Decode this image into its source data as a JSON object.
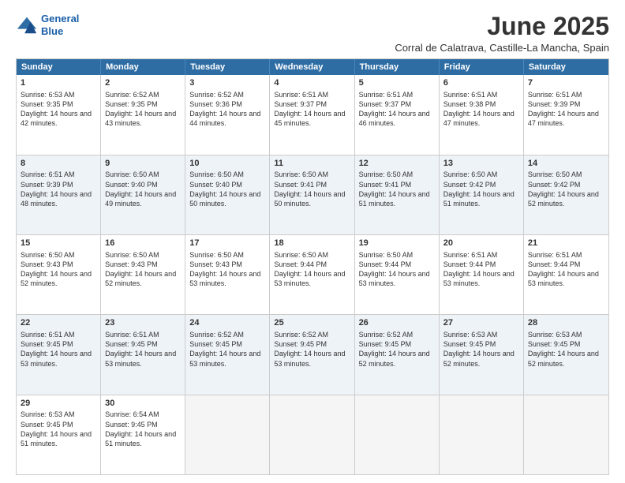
{
  "logo": {
    "line1": "General",
    "line2": "Blue"
  },
  "title": "June 2025",
  "subtitle": "Corral de Calatrava, Castille-La Mancha, Spain",
  "days": [
    "Sunday",
    "Monday",
    "Tuesday",
    "Wednesday",
    "Thursday",
    "Friday",
    "Saturday"
  ],
  "rows": [
    [
      {
        "num": "1",
        "rise": "Sunrise: 6:53 AM",
        "set": "Sunset: 9:35 PM",
        "day": "Daylight: 14 hours and 42 minutes."
      },
      {
        "num": "2",
        "rise": "Sunrise: 6:52 AM",
        "set": "Sunset: 9:35 PM",
        "day": "Daylight: 14 hours and 43 minutes."
      },
      {
        "num": "3",
        "rise": "Sunrise: 6:52 AM",
        "set": "Sunset: 9:36 PM",
        "day": "Daylight: 14 hours and 44 minutes."
      },
      {
        "num": "4",
        "rise": "Sunrise: 6:51 AM",
        "set": "Sunset: 9:37 PM",
        "day": "Daylight: 14 hours and 45 minutes."
      },
      {
        "num": "5",
        "rise": "Sunrise: 6:51 AM",
        "set": "Sunset: 9:37 PM",
        "day": "Daylight: 14 hours and 46 minutes."
      },
      {
        "num": "6",
        "rise": "Sunrise: 6:51 AM",
        "set": "Sunset: 9:38 PM",
        "day": "Daylight: 14 hours and 47 minutes."
      },
      {
        "num": "7",
        "rise": "Sunrise: 6:51 AM",
        "set": "Sunset: 9:39 PM",
        "day": "Daylight: 14 hours and 47 minutes."
      }
    ],
    [
      {
        "num": "8",
        "rise": "Sunrise: 6:51 AM",
        "set": "Sunset: 9:39 PM",
        "day": "Daylight: 14 hours and 48 minutes."
      },
      {
        "num": "9",
        "rise": "Sunrise: 6:50 AM",
        "set": "Sunset: 9:40 PM",
        "day": "Daylight: 14 hours and 49 minutes."
      },
      {
        "num": "10",
        "rise": "Sunrise: 6:50 AM",
        "set": "Sunset: 9:40 PM",
        "day": "Daylight: 14 hours and 50 minutes."
      },
      {
        "num": "11",
        "rise": "Sunrise: 6:50 AM",
        "set": "Sunset: 9:41 PM",
        "day": "Daylight: 14 hours and 50 minutes."
      },
      {
        "num": "12",
        "rise": "Sunrise: 6:50 AM",
        "set": "Sunset: 9:41 PM",
        "day": "Daylight: 14 hours and 51 minutes."
      },
      {
        "num": "13",
        "rise": "Sunrise: 6:50 AM",
        "set": "Sunset: 9:42 PM",
        "day": "Daylight: 14 hours and 51 minutes."
      },
      {
        "num": "14",
        "rise": "Sunrise: 6:50 AM",
        "set": "Sunset: 9:42 PM",
        "day": "Daylight: 14 hours and 52 minutes."
      }
    ],
    [
      {
        "num": "15",
        "rise": "Sunrise: 6:50 AM",
        "set": "Sunset: 9:43 PM",
        "day": "Daylight: 14 hours and 52 minutes."
      },
      {
        "num": "16",
        "rise": "Sunrise: 6:50 AM",
        "set": "Sunset: 9:43 PM",
        "day": "Daylight: 14 hours and 52 minutes."
      },
      {
        "num": "17",
        "rise": "Sunrise: 6:50 AM",
        "set": "Sunset: 9:43 PM",
        "day": "Daylight: 14 hours and 53 minutes."
      },
      {
        "num": "18",
        "rise": "Sunrise: 6:50 AM",
        "set": "Sunset: 9:44 PM",
        "day": "Daylight: 14 hours and 53 minutes."
      },
      {
        "num": "19",
        "rise": "Sunrise: 6:50 AM",
        "set": "Sunset: 9:44 PM",
        "day": "Daylight: 14 hours and 53 minutes."
      },
      {
        "num": "20",
        "rise": "Sunrise: 6:51 AM",
        "set": "Sunset: 9:44 PM",
        "day": "Daylight: 14 hours and 53 minutes."
      },
      {
        "num": "21",
        "rise": "Sunrise: 6:51 AM",
        "set": "Sunset: 9:44 PM",
        "day": "Daylight: 14 hours and 53 minutes."
      }
    ],
    [
      {
        "num": "22",
        "rise": "Sunrise: 6:51 AM",
        "set": "Sunset: 9:45 PM",
        "day": "Daylight: 14 hours and 53 minutes."
      },
      {
        "num": "23",
        "rise": "Sunrise: 6:51 AM",
        "set": "Sunset: 9:45 PM",
        "day": "Daylight: 14 hours and 53 minutes."
      },
      {
        "num": "24",
        "rise": "Sunrise: 6:52 AM",
        "set": "Sunset: 9:45 PM",
        "day": "Daylight: 14 hours and 53 minutes."
      },
      {
        "num": "25",
        "rise": "Sunrise: 6:52 AM",
        "set": "Sunset: 9:45 PM",
        "day": "Daylight: 14 hours and 53 minutes."
      },
      {
        "num": "26",
        "rise": "Sunrise: 6:52 AM",
        "set": "Sunset: 9:45 PM",
        "day": "Daylight: 14 hours and 52 minutes."
      },
      {
        "num": "27",
        "rise": "Sunrise: 6:53 AM",
        "set": "Sunset: 9:45 PM",
        "day": "Daylight: 14 hours and 52 minutes."
      },
      {
        "num": "28",
        "rise": "Sunrise: 6:53 AM",
        "set": "Sunset: 9:45 PM",
        "day": "Daylight: 14 hours and 52 minutes."
      }
    ],
    [
      {
        "num": "29",
        "rise": "Sunrise: 6:53 AM",
        "set": "Sunset: 9:45 PM",
        "day": "Daylight: 14 hours and 51 minutes."
      },
      {
        "num": "30",
        "rise": "Sunrise: 6:54 AM",
        "set": "Sunset: 9:45 PM",
        "day": "Daylight: 14 hours and 51 minutes."
      },
      null,
      null,
      null,
      null,
      null
    ]
  ]
}
